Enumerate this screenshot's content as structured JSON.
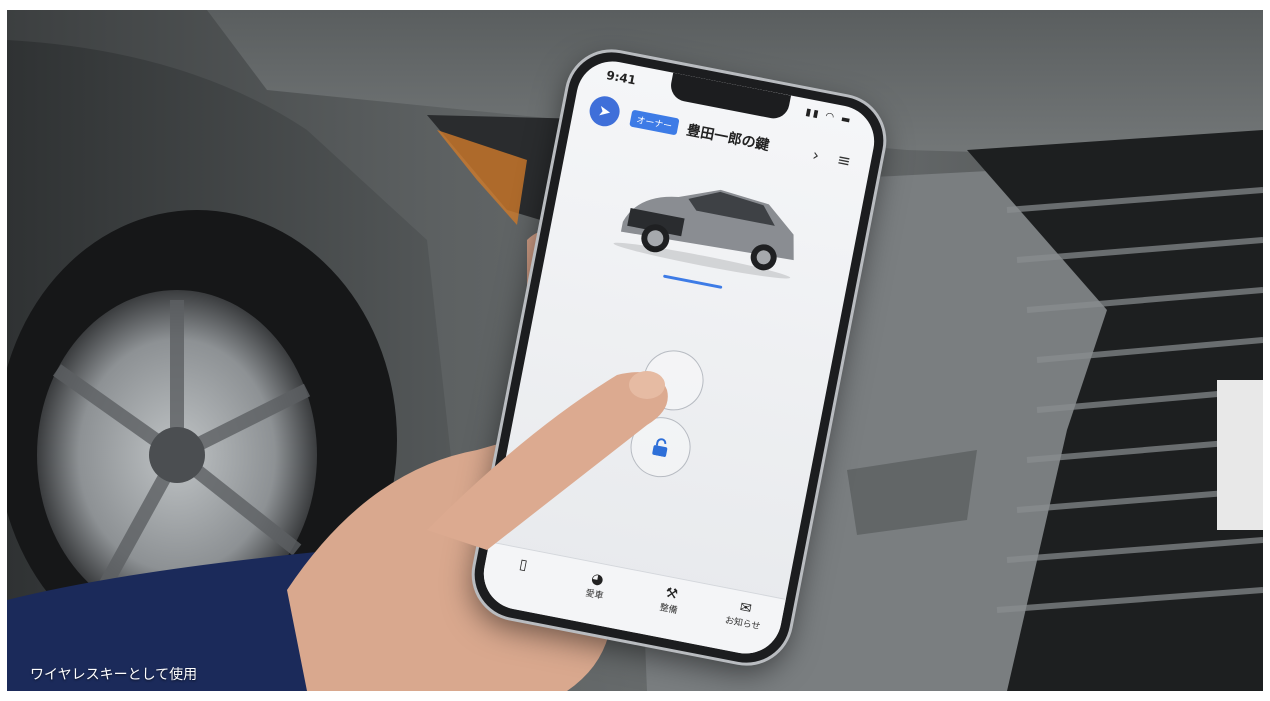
{
  "caption": "ワイヤレスキーとして使用",
  "phone": {
    "status_time": "9:41",
    "key_badge": "オーナー",
    "key_name": "豊田一郎の鍵",
    "tabs": [
      {
        "label": "",
        "icon": "key-card-icon"
      },
      {
        "label": "愛車",
        "icon": "gauge-icon"
      },
      {
        "label": "整備",
        "icon": "wrench-icon"
      },
      {
        "label": "お知らせ",
        "icon": "envelope-icon"
      }
    ]
  },
  "colors": {
    "accent_blue": "#3d7be6",
    "logo_blue": "#3f6fd9",
    "car_body": "#8a8d92"
  }
}
